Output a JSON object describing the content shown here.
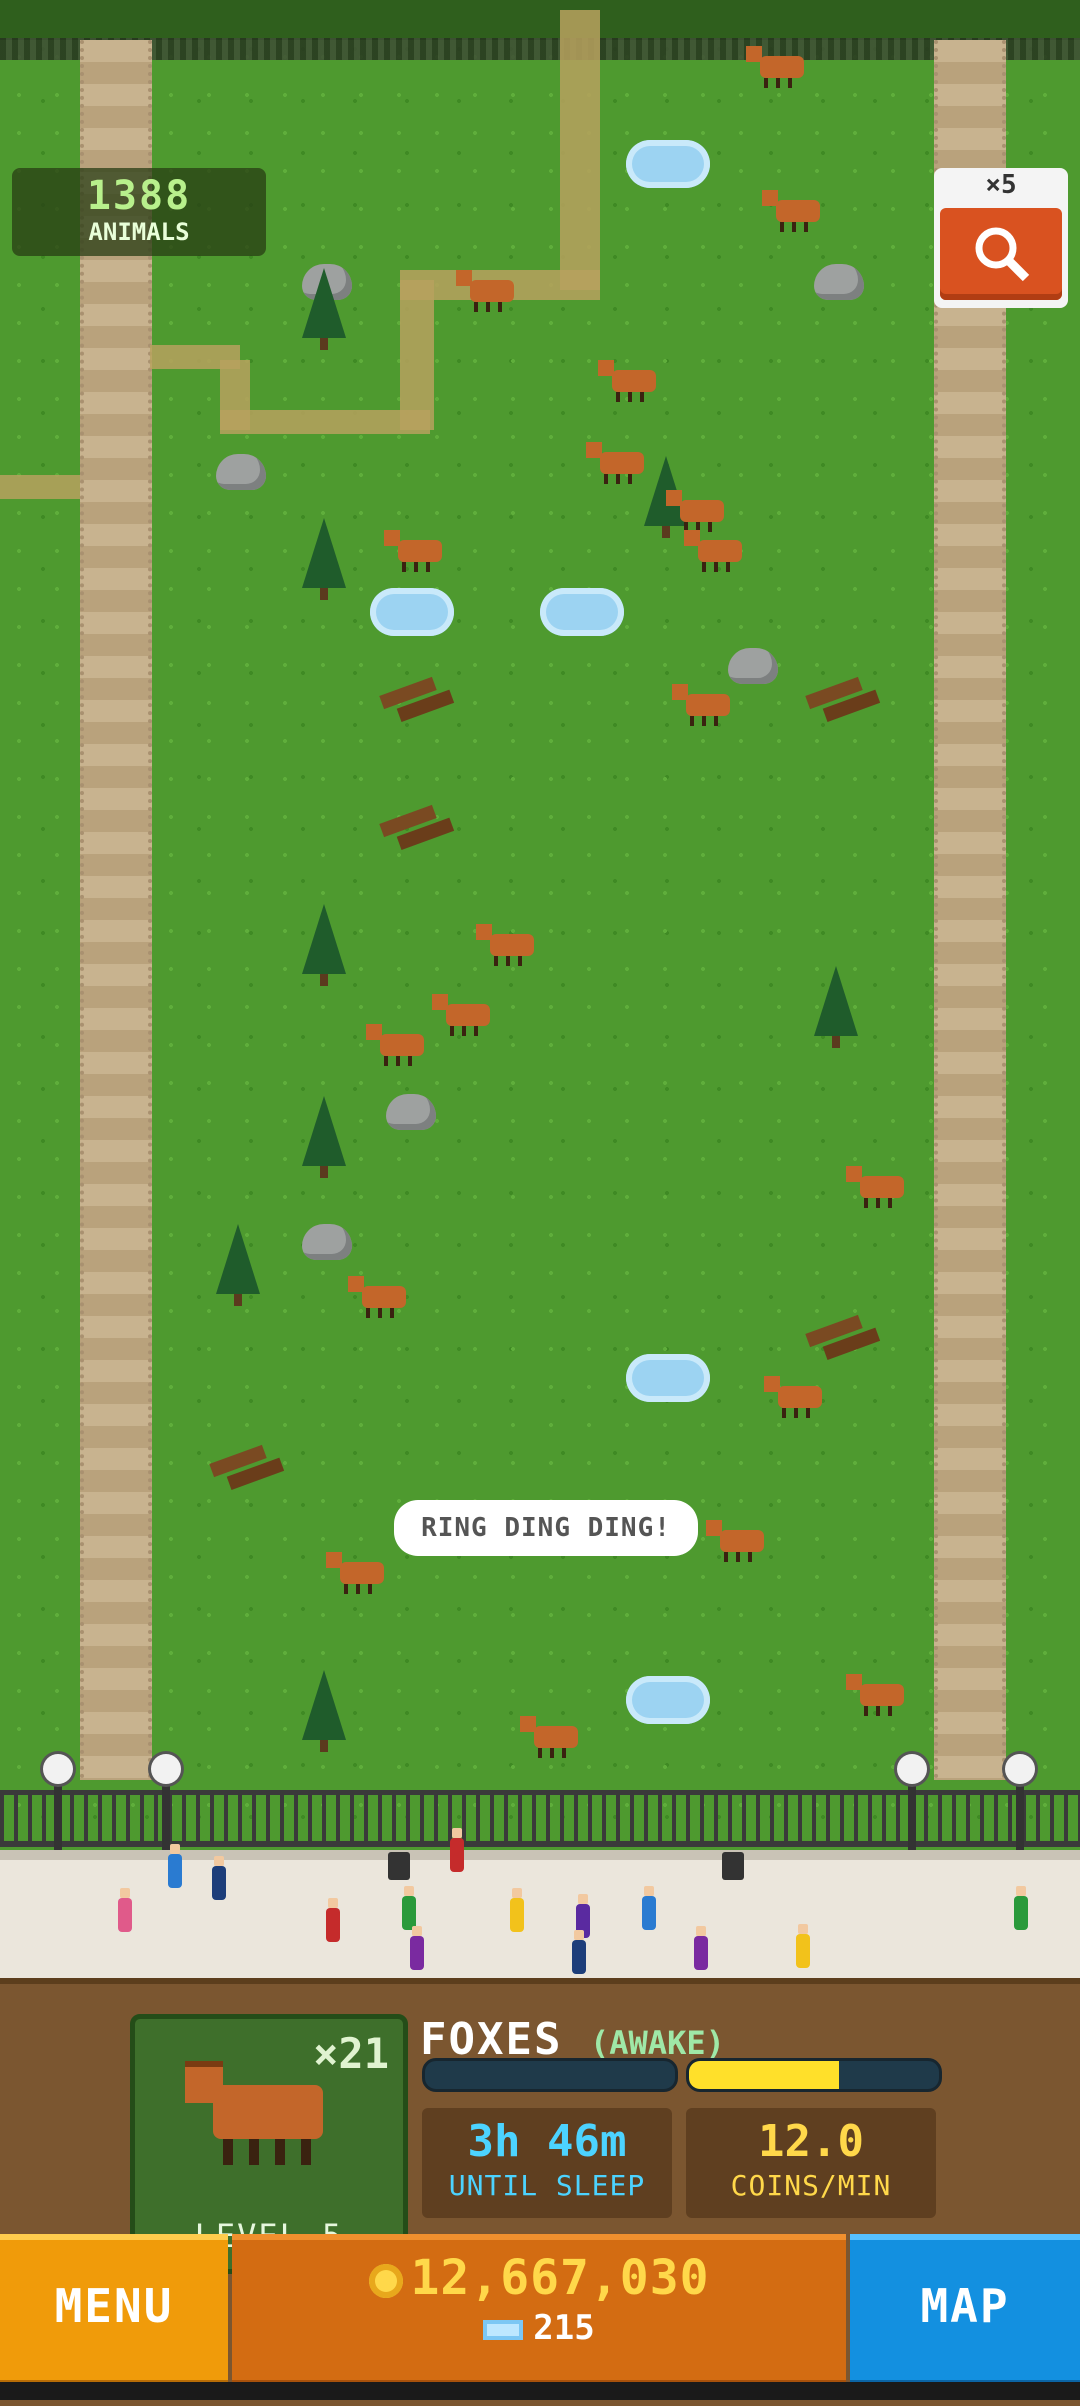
{
  "hud": {
    "animal_count": "1388",
    "animal_label": "ANIMALS",
    "search_multiplier": "×5",
    "search_icon": "magnifier-icon"
  },
  "scene": {
    "speech_bubble": "RING DING DING!"
  },
  "animal_panel": {
    "count": "×21",
    "level": "LEVEL 5",
    "species": "FOXES",
    "status": "(AWAKE)",
    "time_value": "3h 46m",
    "time_label": "UNTIL SLEEP",
    "rate_value": "12.0",
    "rate_label": "COINS/MIN",
    "sleep_progress": 0.0,
    "coin_progress": 0.6
  },
  "bottom_bar": {
    "menu_label": "MENU",
    "coins": "12,667,030",
    "gems": "215",
    "map_label": "MAP"
  },
  "colors": {
    "grass": "#4e9a2f",
    "accent_orange": "#d36c12",
    "menu": "#f09b0a",
    "map": "#1390e0",
    "coin_yellow": "#ffd84a"
  }
}
